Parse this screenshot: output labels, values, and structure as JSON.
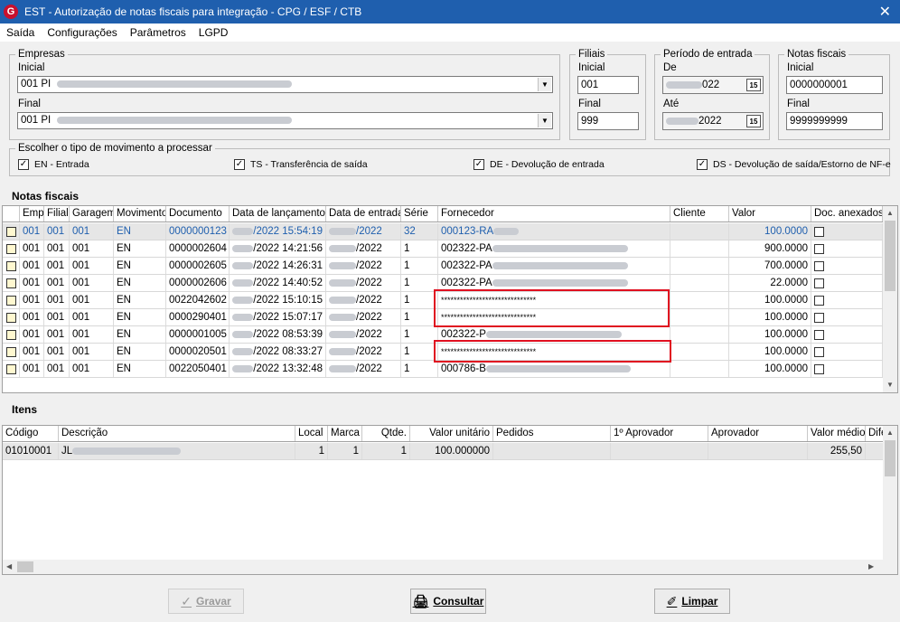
{
  "window": {
    "title": "EST - Autorização de notas fiscais para integração - CPG / ESF / CTB",
    "app_icon": "G"
  },
  "menu": [
    "Saída",
    "Configurações",
    "Parâmetros",
    "LGPD"
  ],
  "empresas": {
    "legend": "Empresas",
    "inicial_label": "Inicial",
    "inicial_value": "001 PI",
    "final_label": "Final",
    "final_value": "001 PI"
  },
  "filiais": {
    "legend": "Filiais",
    "inicial_label": "Inicial",
    "inicial_value": "001",
    "final_label": "Final",
    "final_value": "999"
  },
  "periodo": {
    "legend": "Período de entrada",
    "de_label": "De",
    "de_value": "022",
    "ate_label": "Até",
    "ate_value": "2022",
    "cal_icon": "15"
  },
  "notas": {
    "legend": "Notas fiscais",
    "inicial_label": "Inicial",
    "inicial_value": "0000000001",
    "final_label": "Final",
    "final_value": "9999999999"
  },
  "movimento": {
    "legend": "Escolher o tipo de movimento a processar",
    "options": [
      {
        "label": "EN - Entrada",
        "checked": true
      },
      {
        "label": "TS - Transferência de saída",
        "checked": true
      },
      {
        "label": "DE - Devolução de entrada",
        "checked": true
      },
      {
        "label": "DS - Devolução de saída/Estorno de NF-e",
        "checked": true
      }
    ]
  },
  "notas_grid": {
    "title": "Notas fiscais",
    "headers": [
      "Emp",
      "Filial",
      "Garagem",
      "Movimento",
      "Documento",
      "Data de lançamento",
      "Data de entrada",
      "Série",
      "Fornecedor",
      "Cliente",
      "Valor",
      "Doc. anexados"
    ],
    "rows": [
      {
        "emp": "001",
        "filial": "001",
        "garagem": "001",
        "mov": "EN",
        "doc": "0000000123",
        "lanc": "/2022 15:54:19",
        "entrada": "/2022",
        "serie": "32",
        "forn": "000123-RA",
        "valor": "100.0000"
      },
      {
        "emp": "001",
        "filial": "001",
        "garagem": "001",
        "mov": "EN",
        "doc": "0000002604",
        "lanc": "/2022 14:21:56",
        "entrada": "/2022",
        "serie": "1",
        "forn": "002322-PA",
        "valor": "900.0000"
      },
      {
        "emp": "001",
        "filial": "001",
        "garagem": "001",
        "mov": "EN",
        "doc": "0000002605",
        "lanc": "/2022 14:26:31",
        "entrada": "/2022",
        "serie": "1",
        "forn": "002322-PA",
        "valor": "700.0000"
      },
      {
        "emp": "001",
        "filial": "001",
        "garagem": "001",
        "mov": "EN",
        "doc": "0000002606",
        "lanc": "/2022 14:40:52",
        "entrada": "/2022",
        "serie": "1",
        "forn": "002322-PA",
        "valor": "22.0000"
      },
      {
        "emp": "001",
        "filial": "001",
        "garagem": "001",
        "mov": "EN",
        "doc": "0022042602",
        "lanc": "/2022 15:10:15",
        "entrada": "/2022",
        "serie": "1",
        "forn": "******************************",
        "valor": "100.0000"
      },
      {
        "emp": "001",
        "filial": "001",
        "garagem": "001",
        "mov": "EN",
        "doc": "0000290401",
        "lanc": "/2022 15:07:17",
        "entrada": "/2022",
        "serie": "1",
        "forn": "******************************",
        "valor": "100.0000"
      },
      {
        "emp": "001",
        "filial": "001",
        "garagem": "001",
        "mov": "EN",
        "doc": "0000001005",
        "lanc": "/2022 08:53:39",
        "entrada": "/2022",
        "serie": "1",
        "forn": "002322-P",
        "valor": "100.0000"
      },
      {
        "emp": "001",
        "filial": "001",
        "garagem": "001",
        "mov": "EN",
        "doc": "0000020501",
        "lanc": "/2022 08:33:27",
        "entrada": "/2022",
        "serie": "1",
        "forn": "******************************",
        "valor": "100.0000"
      },
      {
        "emp": "001",
        "filial": "001",
        "garagem": "001",
        "mov": "EN",
        "doc": "0022050401",
        "lanc": "/2022 13:32:48",
        "entrada": "/2022",
        "serie": "1",
        "forn": "000786-B",
        "valor": "100.0000"
      }
    ]
  },
  "itens_grid": {
    "title": "Itens",
    "headers": [
      "Código",
      "Descrição",
      "Local",
      "Marca",
      "Qtde.",
      "Valor unitário",
      "Pedidos",
      "1º Aprovador",
      "Aprovador",
      "Valor médio",
      "Dife"
    ],
    "rows": [
      {
        "codigo": "01010001",
        "descricao": "JL",
        "local": "1",
        "marca": "1",
        "qtde": "1",
        "valor_unit": "100.000000",
        "pedidos": "",
        "aprov1": "",
        "aprov": "",
        "valor_medio": "255,50"
      }
    ]
  },
  "buttons": {
    "gravar": "Gravar",
    "consultar": "Consultar",
    "limpar": "Limpar"
  }
}
